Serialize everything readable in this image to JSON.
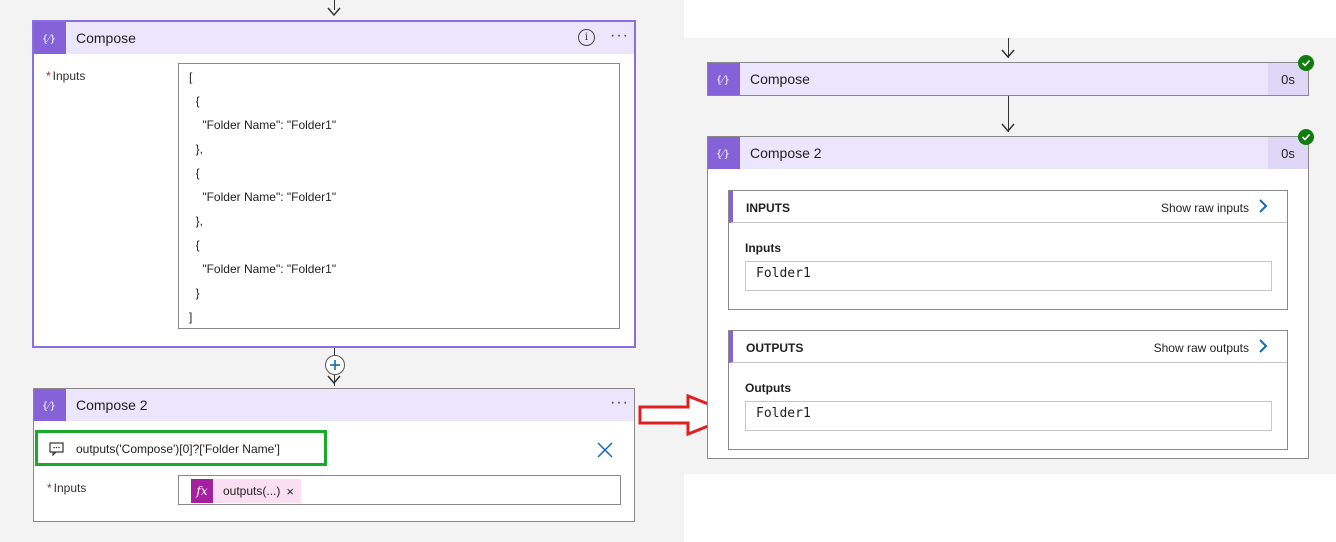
{
  "left": {
    "compose": {
      "title": "Compose",
      "inputs_label": "Inputs",
      "required_mark": "*",
      "json_lines": [
        "[",
        "  {",
        "    \"Folder Name\": \"Folder1\"",
        "  },",
        "  {",
        "    \"Folder Name\": \"Folder1\"",
        "  },",
        "  {",
        "    \"Folder Name\": \"Folder1\"",
        "  }",
        "]"
      ],
      "info_icon": "info-icon",
      "more_label": "···"
    },
    "compose2": {
      "title": "Compose 2",
      "more_label": "···",
      "expression": "outputs('Compose')[0]?['Folder Name']",
      "inputs_label": "Inputs",
      "required_mark": "*",
      "token_label": "outputs(...)",
      "token_fx": "fx",
      "token_remove": "×"
    }
  },
  "right": {
    "compose": {
      "title": "Compose",
      "duration": "0s",
      "status": "succeeded"
    },
    "compose2": {
      "title": "Compose 2",
      "duration": "0s",
      "status": "succeeded",
      "inputs_section": {
        "title": "INPUTS",
        "show_raw": "Show raw inputs",
        "field_label": "Inputs",
        "value": "Folder1"
      },
      "outputs_section": {
        "title": "OUTPUTS",
        "show_raw": "Show raw outputs",
        "field_label": "Outputs",
        "value": "Folder1"
      }
    }
  },
  "colors": {
    "accent": "#8662d9",
    "header_bg": "#ebe6fb",
    "selected_border": "#8a6fe0",
    "highlight_green": "#1aaa2a",
    "annotation_red": "#e02020",
    "success": "#107c10"
  }
}
